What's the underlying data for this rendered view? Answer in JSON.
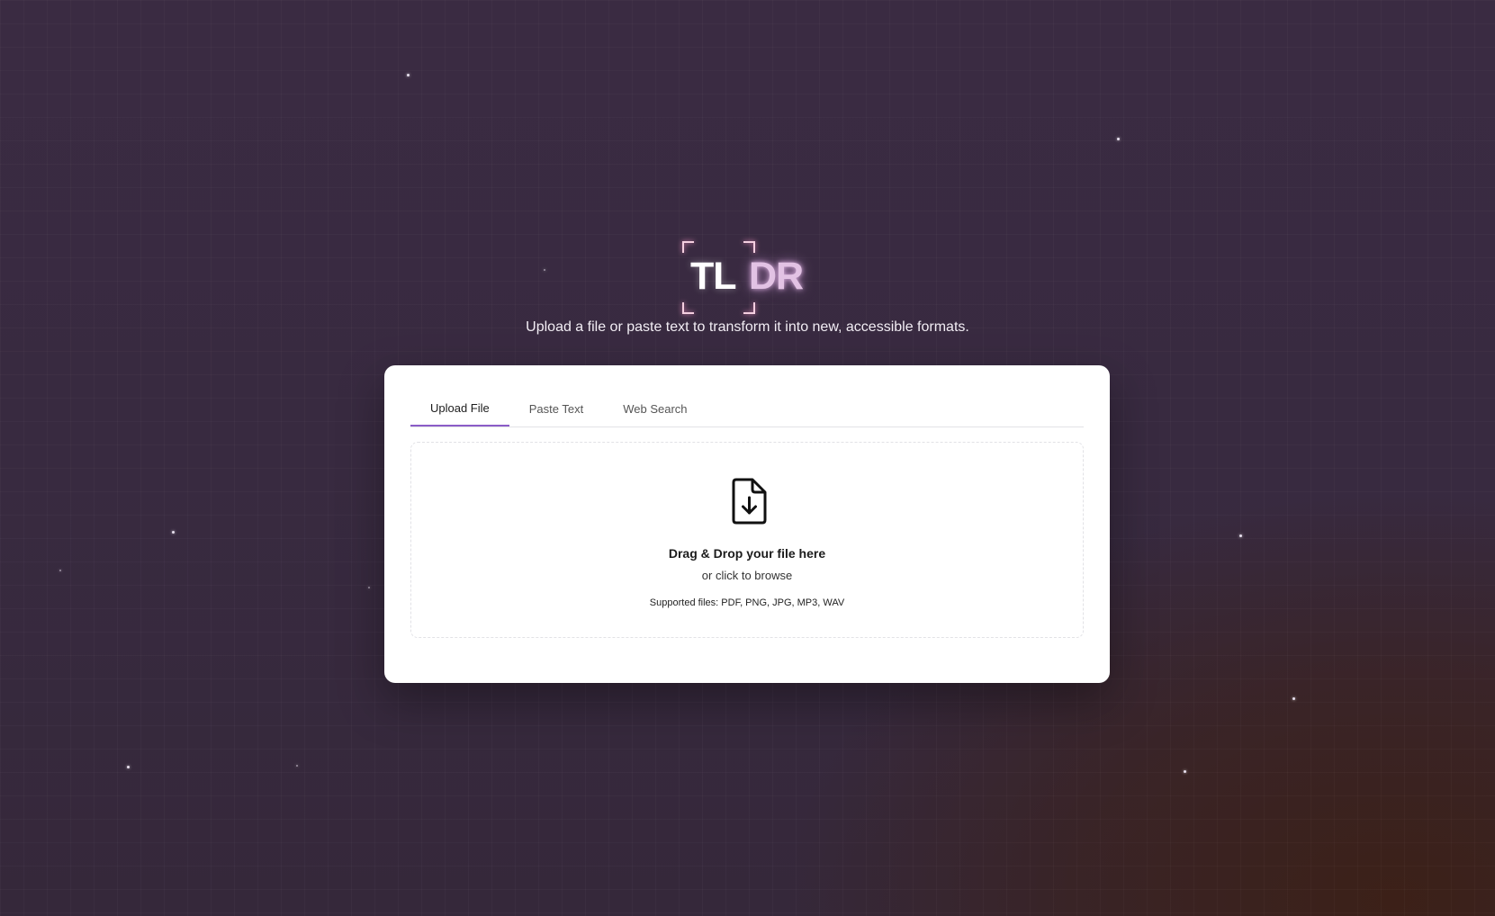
{
  "logo": {
    "part1": "TL",
    "part2": "DR"
  },
  "tagline": "Upload a file or paste text to transform it into new, accessible formats.",
  "tabs": [
    {
      "label": "Upload File",
      "active": true
    },
    {
      "label": "Paste Text",
      "active": false
    },
    {
      "label": "Web Search",
      "active": false
    }
  ],
  "dropzone": {
    "icon": "file-download-icon",
    "title": "Drag & Drop your file here",
    "subtitle": "or click to browse",
    "supported": "Supported files: PDF, PNG, JPG, MP3, WAV"
  },
  "colors": {
    "background": "#392a40",
    "accent": "#8b5cc7",
    "logo_glow": "#f4cfe0",
    "card": "#ffffff"
  }
}
